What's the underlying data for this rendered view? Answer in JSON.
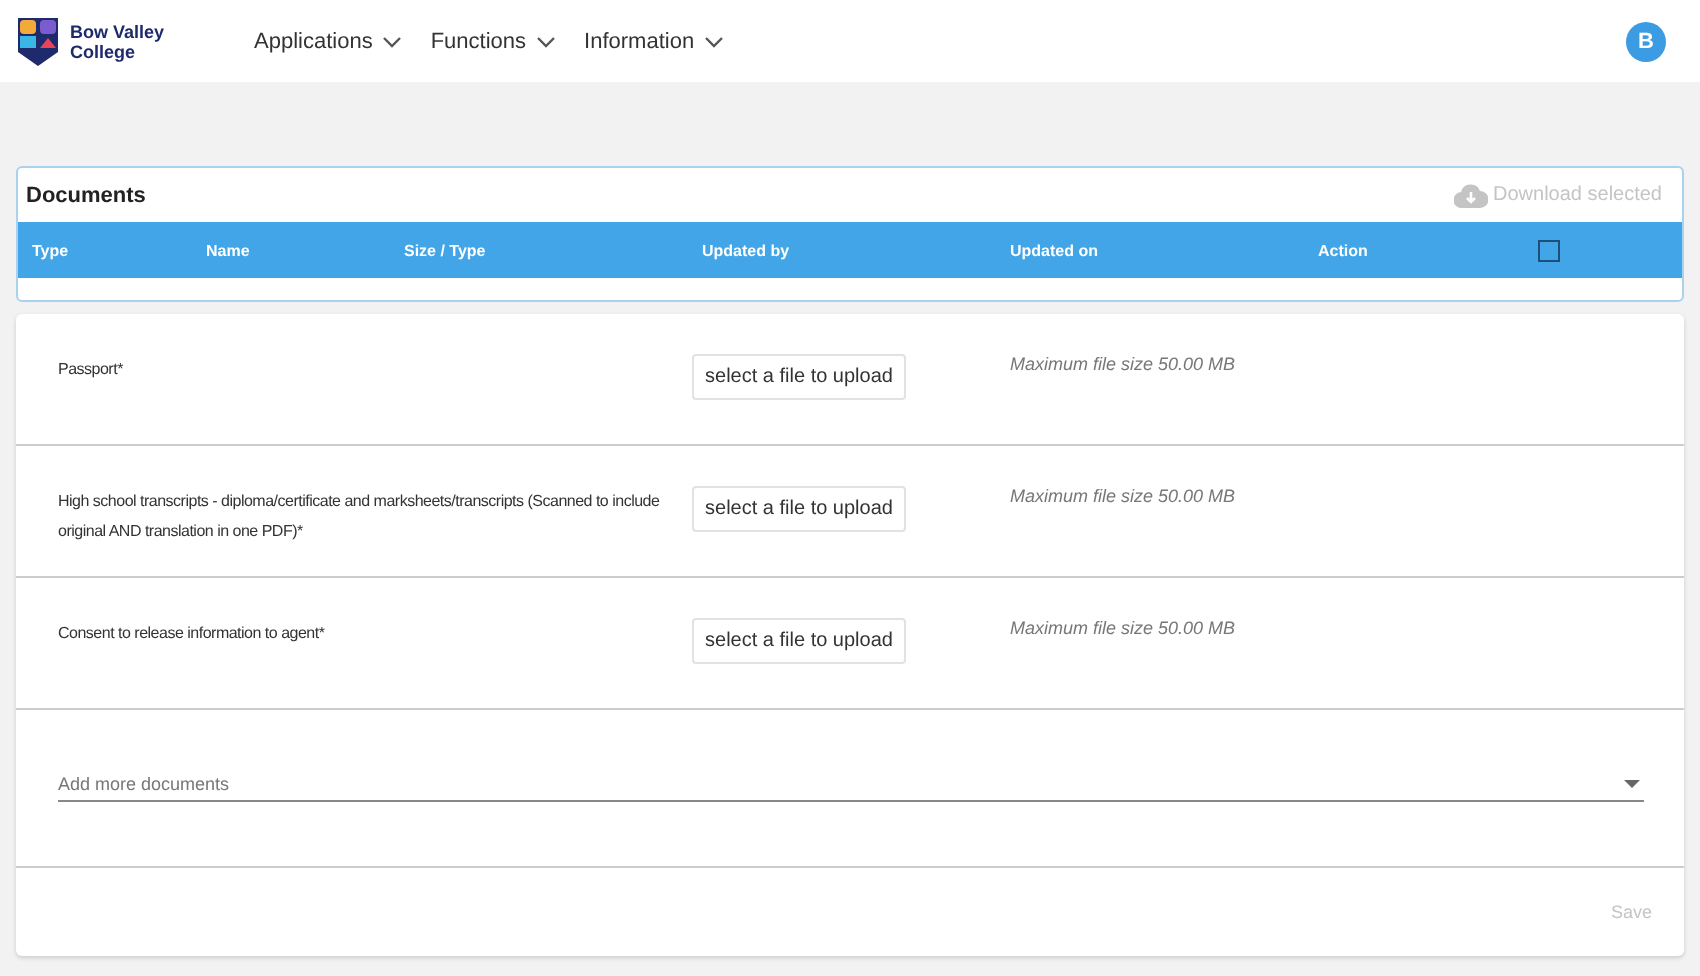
{
  "header": {
    "logo_text": "Bow Valley College",
    "nav": [
      {
        "label": "Applications"
      },
      {
        "label": "Functions"
      },
      {
        "label": "Information"
      }
    ],
    "avatar": "B"
  },
  "documents": {
    "title": "Documents",
    "download": {
      "label": "Download selected",
      "disabled": true
    },
    "columns": [
      "Type",
      "Name",
      "Size / Type",
      "Updated by",
      "Updated on",
      "Action"
    ],
    "select_all": {
      "checked": false
    }
  },
  "uploads": [
    {
      "label": "Passport*",
      "button": "select a file to upload",
      "note": "Maximum file size 50.00 MB"
    },
    {
      "label": "High school transcripts - diploma/certificate and marksheets/transcripts (Scanned to include original AND translation in one PDF)*",
      "button": "select a file to upload",
      "note": "Maximum file size 50.00 MB"
    },
    {
      "label": "Consent to release information to agent*",
      "button": "select a file to upload",
      "note": "Maximum file size 50.00 MB"
    }
  ],
  "add_more": {
    "placeholder": "Add more documents"
  },
  "save": {
    "label": "Save",
    "disabled": true
  }
}
